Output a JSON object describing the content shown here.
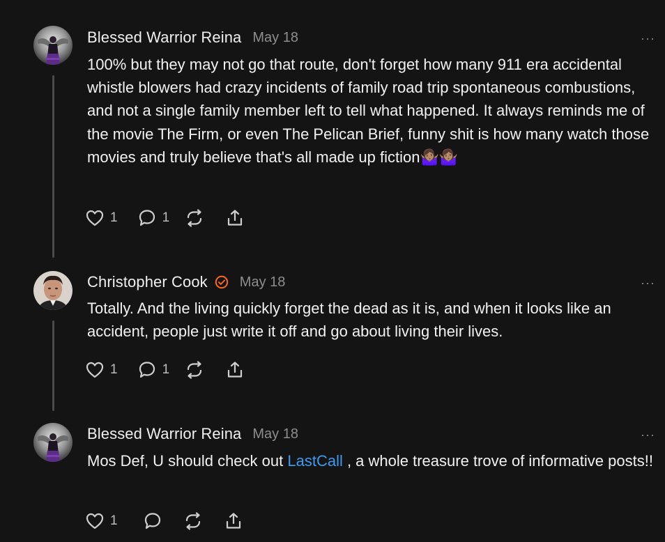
{
  "comments": [
    {
      "author": "Blessed Warrior Reina",
      "date": "May 18",
      "more": "···",
      "text": "100% but they may not go that route, don't forget how many 911 era accidental whistle blowers had crazy incidents of family road trip spontaneous combustions, and not a single family member left to tell what happened. It always reminds me of the movie The Firm, or even The Pelican Brief, funny shit is how many watch those movies and truly believe that's all made up fiction🤷🏽‍♀️🤷🏽‍♀️",
      "likes": "1",
      "replies": "1"
    },
    {
      "author": "Christopher Cook",
      "date": "May 18",
      "more": "···",
      "verified_color": "#ff6719",
      "text": "Totally. And the living quickly forget the dead as it is, and when it looks like an accident, people just write it off and go about living their lives.",
      "likes": "1",
      "replies": "1"
    },
    {
      "author": "Blessed Warrior Reina",
      "date": "May 18",
      "more": "···",
      "text_before": "Mos Def, U should check out ",
      "link": "LastCall",
      "text_after": " , a whole treasure trove of informative posts!!",
      "likes": "1"
    }
  ],
  "icons": {
    "like": "heart-icon",
    "reply": "comment-bubble-icon",
    "restack": "restack-icon",
    "share": "share-icon",
    "more": "more-options-icon",
    "verified": "verified-badge-icon"
  },
  "colors": {
    "background": "#141414",
    "link": "#3b9bf2",
    "verified": "#ff6719",
    "muted": "#8e8e8e"
  }
}
